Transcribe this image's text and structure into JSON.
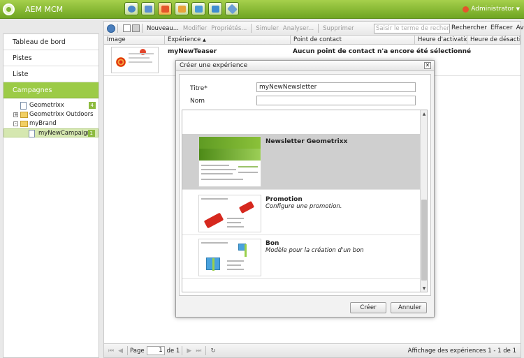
{
  "app": {
    "title": "AEM MCM",
    "user": "Administrator"
  },
  "topbar": {
    "icons": [
      {
        "name": "dashboard-icon",
        "color": "#4a86c8"
      },
      {
        "name": "reports-icon",
        "color": "#5b8fd0"
      },
      {
        "name": "campaign-icon",
        "color": "#e4552b"
      },
      {
        "name": "mail-icon",
        "color": "#e8a33a"
      },
      {
        "name": "photo-icon",
        "color": "#4a9ad6"
      },
      {
        "name": "image-icon",
        "color": "#3f8dd0"
      },
      {
        "name": "tag-icon",
        "color": "#6c9fd4"
      }
    ]
  },
  "sidebar": {
    "items": [
      {
        "label": "Tableau de bord"
      },
      {
        "label": "Pistes"
      },
      {
        "label": "Liste"
      },
      {
        "label": "Campagnes"
      }
    ],
    "tree": [
      {
        "label": "Geometrixx",
        "badge": "4"
      },
      {
        "label": "Geometrixx Outdoors",
        "expander": "+"
      },
      {
        "label": "myBrand",
        "expander": "-"
      },
      {
        "label": "myNewCampaign",
        "badge": "1"
      }
    ]
  },
  "toolbar": {
    "new": "Nouveau...",
    "edit": "Modifier",
    "properties": "Propriétés...",
    "simulate": "Simuler",
    "analyze": "Analyser...",
    "delete": "Supprimer",
    "search_placeholder": "Saisir le terme de recherche",
    "search": "Rechercher",
    "clear": "Effacer",
    "advanced": "Avancé"
  },
  "grid": {
    "columns": [
      "Image",
      "Expérience",
      "Point de contact",
      "Heure d'activation",
      "Heure de désactivation"
    ],
    "rows": [
      {
        "experience": "myNewTeaser",
        "touchpoint": "Aucun point de contact n'a encore été sélectionné"
      }
    ]
  },
  "footer": {
    "page_label": "Page",
    "page_value": "1",
    "page_of": "de 1",
    "info": "Affichage des expériences 1 - 1 de 1"
  },
  "dialog": {
    "title": "Créer une expérience",
    "title_label": "Titre*",
    "title_value": "myNewNewsletter",
    "name_label": "Nom",
    "name_value": "",
    "templates": [
      {
        "name": "Newsletter Geometrixx",
        "desc": ""
      },
      {
        "name": "Promotion",
        "desc": "Configure une promotion."
      },
      {
        "name": "Bon",
        "desc": "Modèle pour la création d'un bon"
      }
    ],
    "create": "Créer",
    "cancel": "Annuler"
  }
}
